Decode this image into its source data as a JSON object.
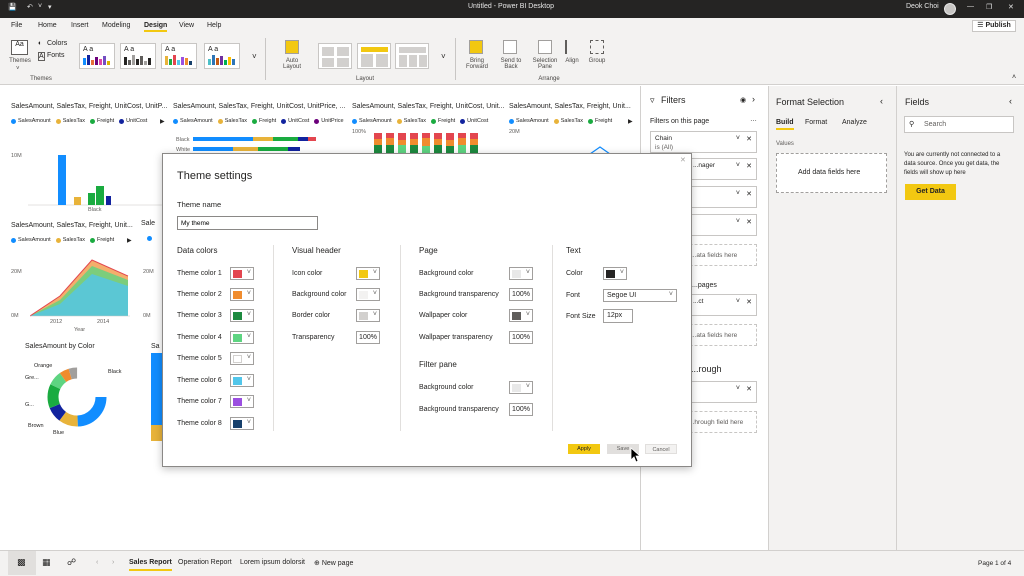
{
  "window": {
    "title": "Untitled - Power BI Desktop",
    "user": "Deok Choi"
  },
  "menu": {
    "tabs": [
      "File",
      "Home",
      "Insert",
      "Modeling",
      "Design",
      "View",
      "Help"
    ],
    "active": "Design",
    "publish_label": "Publish"
  },
  "ribbon": {
    "themes_label": "Themes",
    "colors_label": "Colors",
    "fonts_label": "Fonts",
    "themes_group": "Themes",
    "auto_layout": "Auto Layout",
    "layout_group": "Layout",
    "bring_forward": "Bring Forward",
    "send_to_back": "Send to Back",
    "selection_pane": "Selection Pane",
    "align": "Align",
    "group": "Group",
    "arrange_group": "Arrange",
    "theme_thumb_text": "A a"
  },
  "canvas": {
    "visuals": [
      {
        "title": "SalesAmount, SalesTax, Freight, UnitCost, UnitP...",
        "legend": [
          "SalesAmount",
          "SalesTax",
          "Freight",
          "UnitCost"
        ]
      },
      {
        "title": "SalesAmount, SalesTax, Freight, UnitCost, UnitPrice, ...",
        "legend": [
          "SalesAmount",
          "SalesTax",
          "Freight",
          "UnitCost",
          "UnitPrice"
        ]
      },
      {
        "title": "SalesAmount, SalesTax, Freight, UnitCost, Unit...",
        "legend": [
          "SalesAmount",
          "SalesTax",
          "Freight",
          "UnitCost"
        ]
      },
      {
        "title": "SalesAmount, SalesTax, Freight, Unit...",
        "legend": [
          "SalesAmount",
          "SalesTax",
          "Freight"
        ]
      },
      {
        "title": "SalesAmount, SalesTax, Freight, Unit...",
        "legend": [
          "SalesAmount",
          "SalesTax",
          "Freight"
        ]
      },
      {
        "title": "SalesAmount by Color"
      }
    ],
    "axis": {
      "y10m": "10M",
      "y20m": "20M",
      "y0m": "0M",
      "y100": "100%",
      "x_black": "Black",
      "x2012": "2012",
      "x2014": "2014",
      "year": "Year",
      "black": "Black",
      "white": "White"
    },
    "donut_labels": [
      "Orange",
      "Gre...",
      "G...",
      "Brown",
      "Blue",
      "Black"
    ]
  },
  "filters": {
    "title": "Filters",
    "on_this_page": "Filters on this page",
    "cards": [
      {
        "title": "Chain",
        "sub": "is (All)"
      },
      {
        "title": "...nager",
        "sub": ""
      },
      {
        "title": "",
        "sub": ""
      },
      {
        "title": "",
        "sub": ""
      },
      {
        "title": "...ct",
        "sub": ""
      },
      {
        "title": "",
        "sub": ""
      }
    ],
    "drop_here_1": "...ata fields here",
    "pages_label": "...pages",
    "drop_here_2": "...ata fields here",
    "through_label": "...rough",
    "drop_here_3": "...hrough field here"
  },
  "format": {
    "title": "Format Selection",
    "tabs": [
      "Build",
      "Format",
      "Analyze"
    ],
    "values_label": "Values",
    "add_fields": "Add data fields here"
  },
  "fields": {
    "title": "Fields",
    "search_placeholder": "Search",
    "message": [
      "You are currently not connected to a",
      "data source. Once you get data, the",
      "fields will show up here"
    ],
    "get_data": "Get Data"
  },
  "status": {
    "pages": [
      "Sales Report",
      "Operation Report",
      "Lorem ipsum dolorsit"
    ],
    "new_page": "New page",
    "page_count": "Page 1 of 4"
  },
  "dialog": {
    "title": "Theme settings",
    "theme_name_label": "Theme name",
    "theme_name_value": "My theme",
    "data_colors": {
      "heading": "Data colors",
      "items": [
        {
          "label": "Theme color 1",
          "color": "#e3464f"
        },
        {
          "label": "Theme color 2",
          "color": "#f08c2e"
        },
        {
          "label": "Theme color 3",
          "color": "#1d8a3f"
        },
        {
          "label": "Theme color 4",
          "color": "#5ed481"
        },
        {
          "label": "Theme color 5",
          "color": "#ffffff"
        },
        {
          "label": "Theme color 6",
          "color": "#52c6ea"
        },
        {
          "label": "Theme color 7",
          "color": "#9b4fe0"
        },
        {
          "label": "Theme color 8",
          "color": "#17406b"
        }
      ]
    },
    "visual_header": {
      "heading": "Visual header",
      "icon_color": "Icon color",
      "icon_color_value": "#f2c811",
      "background_color": "Background color",
      "background_color_value": "#f3f2f1",
      "border_color": "Border color",
      "border_color_value": "#d2d0ce",
      "transparency": "Transparency",
      "transparency_value": "100%"
    },
    "page": {
      "heading": "Page",
      "background_color": "Background color",
      "background_color_value": "#e8e8e8",
      "background_transparency": "Background transparency",
      "background_transparency_value": "100%",
      "wallpaper_color": "Wallpaper color",
      "wallpaper_color_value": "#605e5c",
      "wallpaper_transparency": "Wallpaper transparency",
      "wallpaper_transparency_value": "100%"
    },
    "filter_pane": {
      "heading": "Filter pane",
      "background_color": "Background color",
      "background_color_value": "#e8e8e8",
      "background_transparency": "Background transparency",
      "background_transparency_value": "100%"
    },
    "text": {
      "heading": "Text",
      "color": "Color",
      "color_value": "#252423",
      "font": "Font",
      "font_value": "Segoe UI",
      "font_size": "Font Size",
      "font_size_value": "12px"
    },
    "buttons": {
      "apply": "Apply",
      "save": "Save",
      "cancel": "Cancel"
    }
  },
  "colors": {
    "accent": "#f2c811",
    "series1": "#118dff",
    "series2": "#e8b33a",
    "series3": "#1aab40",
    "series4": "#12239e"
  }
}
